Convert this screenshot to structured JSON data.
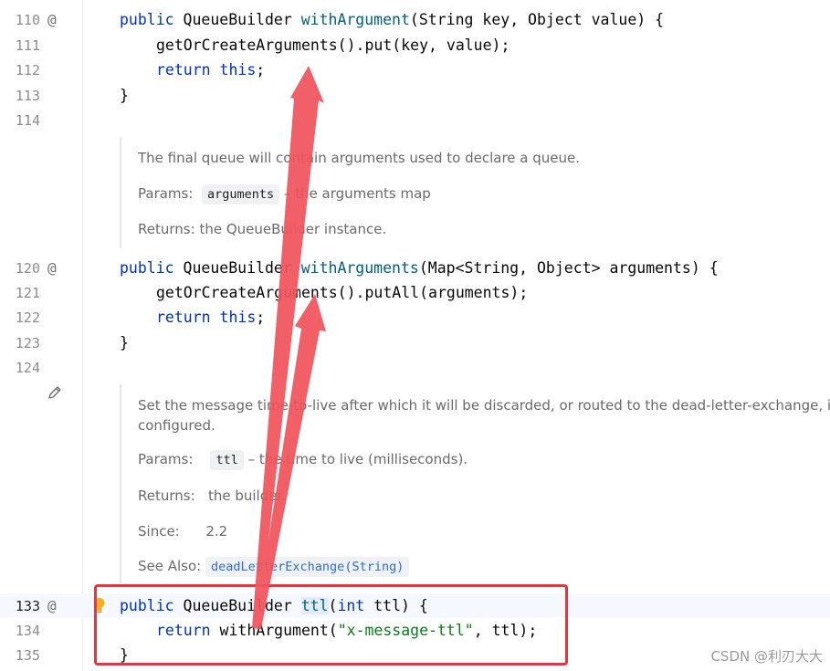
{
  "gutter": {
    "line_numbers": [
      "110",
      "111",
      "112",
      "113",
      "114",
      "120",
      "121",
      "122",
      "123",
      "124",
      "133",
      "134",
      "135"
    ],
    "override_marker": "@"
  },
  "code": {
    "l110": {
      "kw": "public",
      "type": "QueueBuilder",
      "fn": "withArgument",
      "rest": "(String key, Object value) {"
    },
    "l111": {
      "text": "getOrCreateArguments().put(key, value);"
    },
    "l112": {
      "kw1": "return",
      "kw2": "this",
      "semi": ";"
    },
    "l113": {
      "text": "}"
    },
    "l120": {
      "kw": "public",
      "type": "QueueBuilder",
      "fn": "withArguments",
      "rest": "(Map<String, Object> arguments) {"
    },
    "l121": {
      "text": "getOrCreateArguments().putAll(arguments);"
    },
    "l122": {
      "kw1": "return",
      "kw2": "this",
      "semi": ";"
    },
    "l123": {
      "text": "}"
    },
    "l133": {
      "kw": "public",
      "type": "QueueBuilder",
      "fn": "ttl",
      "open": "(",
      "kw_int": "int",
      "rest": " ttl) {"
    },
    "l134": {
      "kw": "return",
      "fn": "withArgument",
      "open": "(",
      "str": "\"x-message-ttl\"",
      "rest": ", ttl);"
    },
    "l135": {
      "text": "}"
    }
  },
  "doc1": {
    "description": "The final queue will contain arguments used to declare a queue.",
    "params_label": "Params:",
    "param_name": "arguments",
    "param_desc": "– the arguments map",
    "returns_label": "Returns:",
    "returns_text": "the QueueBuilder instance."
  },
  "doc2": {
    "description_1": "Set the message time-to-live after which it will be discarded, or routed to the dead-letter-exchange, if so",
    "description_2": "configured.",
    "params_label": "Params:",
    "param_name": "ttl",
    "param_desc": "– the time to live (milliseconds).",
    "returns_label": "Returns:",
    "returns_text": "the builder.",
    "since_label": "Since:",
    "since_text": "2.2",
    "see_also_label": "See Also:",
    "see_also_link": "deadLetterExchange(String)"
  },
  "watermark": "CSDN @利刃大大",
  "colors": {
    "keyword": "#0033b3",
    "method": "#00627a",
    "string": "#067d17",
    "annotation_red": "#e8343c",
    "arrow": "#f0535c"
  },
  "icons": [
    "edit-pencil-icon",
    "intention-bulb-icon"
  ]
}
